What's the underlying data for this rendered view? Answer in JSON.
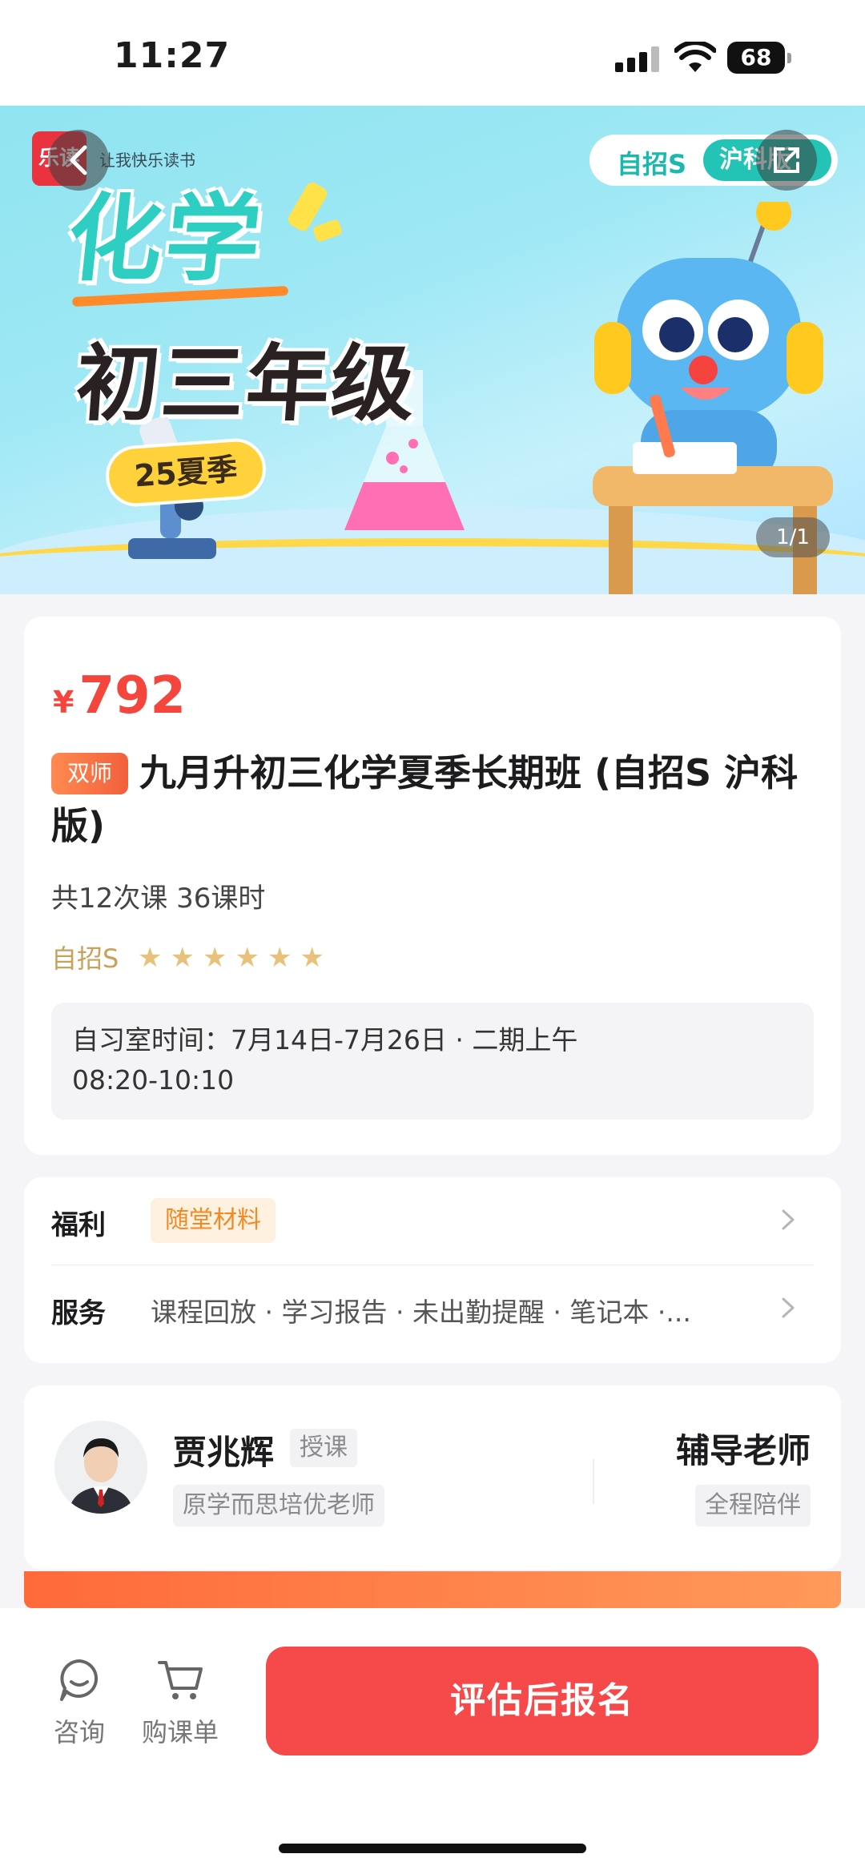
{
  "status_bar": {
    "time": "11:27",
    "battery": "68"
  },
  "hero": {
    "logo_text": "乐读",
    "slogan": "让我快乐读书",
    "subject_title": "化学",
    "grade_title": "初三年级",
    "season_tag": "25夏季",
    "edition_tabs": [
      "自招S",
      "沪科版"
    ],
    "image_counter": "1/1"
  },
  "course": {
    "currency": "¥",
    "price": "792",
    "badge": "双师",
    "title": "九月升初三化学夏季长期班 (自招S 沪科版)",
    "summary": "共12次课 36课时",
    "level_label": "自招S",
    "level_stars": 6,
    "study_room_line1": "自习室时间：7月14日-7月26日 · 二期上午",
    "study_room_line2": "08:20-10:10"
  },
  "benefits": {
    "welfare_label": "福利",
    "welfare_tag": "随堂材料",
    "service_label": "服务",
    "service_text": "课程回放 · 学习报告 · 未出勤提醒 · 笔记本 ·..."
  },
  "teachers": {
    "main_name": "贾兆辉",
    "main_role": "授课",
    "main_desc": "原学而思培优老师",
    "assistant_title": "辅导老师",
    "assistant_desc": "全程陪伴"
  },
  "bottom_bar": {
    "consult_label": "咨询",
    "cart_label": "购课单",
    "cta_label": "评估后报名"
  },
  "colors": {
    "accent": "#f5494a",
    "price": "#f5463e",
    "teal": "#23c4b6"
  }
}
